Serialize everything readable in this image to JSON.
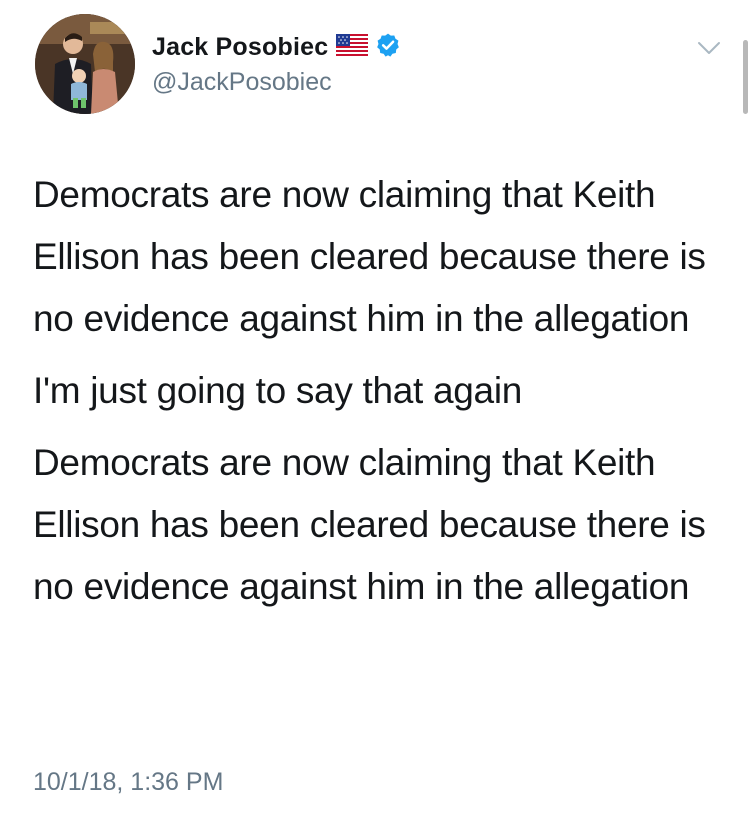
{
  "author": {
    "display_name": "Jack Posobiec",
    "handle": "@JackPosobiec",
    "flag_icon": "us-flag-icon",
    "verified_icon": "verified-badge-icon",
    "verified_color": "#1da1f2"
  },
  "tweet": {
    "paragraphs": [
      "Democrats are now claiming that Keith Ellison has been cleared because there is no evidence against him in the allegation",
      "I'm just going to say that again",
      "Democrats are now claiming that Keith Ellison has been cleared because there is no evidence against him in the allegation"
    ],
    "timestamp": "10/1/18, 1:36 PM"
  },
  "menu": {
    "icon": "chevron-down-icon"
  },
  "colors": {
    "text": "#14171a",
    "secondary_text": "#657786",
    "background": "#ffffff"
  }
}
